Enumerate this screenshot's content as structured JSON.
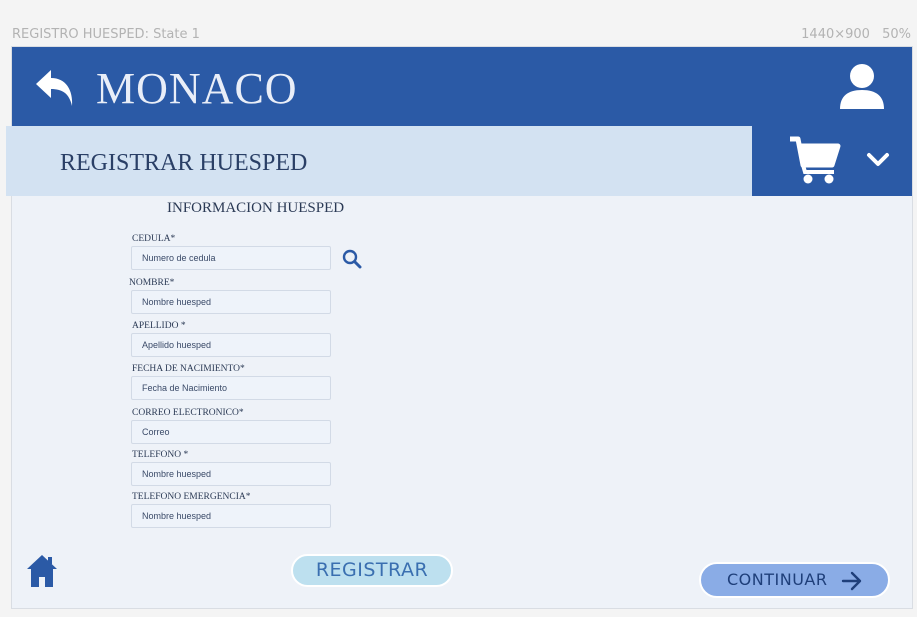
{
  "canvas": {
    "title": "REGISTRO HUESPED: State 1",
    "dimensions": "1440×900",
    "zoom": "50%"
  },
  "header": {
    "brand": "MONACO"
  },
  "subheader": {
    "title": "REGISTRAR HUESPED"
  },
  "form": {
    "section_title": "INFORMACION HUESPED",
    "fields": [
      {
        "label": "CEDULA*",
        "placeholder": "Numero de cedula"
      },
      {
        "label": "NOMBRE*",
        "placeholder": "Nombre huesped"
      },
      {
        "label": "APELLIDO *",
        "placeholder": "Apellido huesped"
      },
      {
        "label": "FECHA DE NACIMIENTO*",
        "placeholder": "Fecha de Nacimiento"
      },
      {
        "label": "CORREO ELECTRONICO*",
        "placeholder": "Correo"
      },
      {
        "label": "TELEFONO *",
        "placeholder": "Nombre huesped"
      },
      {
        "label": "TELEFONO EMERGENCIA*",
        "placeholder": "Nombre huesped"
      }
    ]
  },
  "actions": {
    "register": "REGISTRAR",
    "continue": "CONTINUAR"
  },
  "icons": {
    "back": "back-arrow-icon",
    "user": "user-icon",
    "cart": "cart-icon",
    "dropdown": "chevron-down-icon",
    "search": "search-icon",
    "home": "home-icon",
    "continue_arrow": "arrow-right-icon"
  },
  "colors": {
    "header": "#2b5aa6",
    "subheader": "#d3e2f2",
    "register_button": "#bde0ef",
    "continue_button": "#8aace6"
  }
}
